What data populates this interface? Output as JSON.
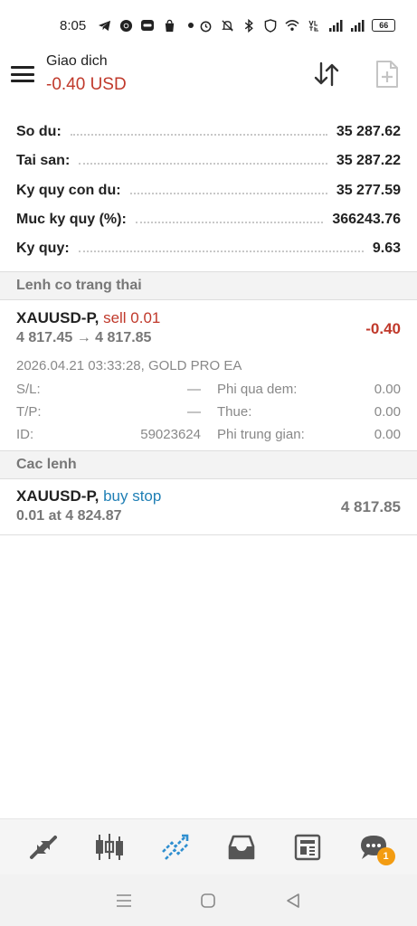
{
  "status_bar": {
    "time": "8:05",
    "battery": "66",
    "left_icons": [
      "telegram-icon",
      "chrome-icon",
      "zalo-icon",
      "shopee-icon",
      "dot-icon"
    ],
    "right_icons": [
      "alarm-icon",
      "mute-icon",
      "bluetooth-icon",
      "shield-icon",
      "wifi-icon",
      "volte-icon",
      "signal-icon",
      "signal-icon"
    ]
  },
  "header": {
    "title": "Giao dich",
    "profit": "-0.40 USD",
    "colors": {
      "loss": "#c0392b"
    }
  },
  "summary": [
    {
      "label": "So du:",
      "value": "35 287.62"
    },
    {
      "label": "Tai san:",
      "value": "35 287.22"
    },
    {
      "label": "Ky quy con du:",
      "value": "35 277.59"
    },
    {
      "label": "Muc ky quy (%):",
      "value": "366243.76"
    },
    {
      "label": "Ky quy:",
      "value": "9.63"
    }
  ],
  "sections": {
    "positions": "Lenh co trang thai",
    "orders": "Cac lenh"
  },
  "position": {
    "symbol": "XAUUSD-P,",
    "side": "sell 0.01",
    "prices": "4 817.45 → 4 817.85",
    "profit": "-0.40",
    "time_ea": "2026.04.21 03:33:28, GOLD PRO EA",
    "sl_label": "S/L:",
    "sl_value": "—",
    "tp_label": "T/P:",
    "tp_value": "—",
    "id_label": "ID:",
    "id_value": "59023624",
    "swap_label": "Phi qua dem:",
    "swap_value": "0.00",
    "tax_label": "Thue:",
    "tax_value": "0.00",
    "commission_label": "Phi trung gian:",
    "commission_value": "0.00"
  },
  "order": {
    "symbol": "XAUUSD-P,",
    "type": "buy stop",
    "volume_price": "0.01 at 4 824.87",
    "current_price": "4 817.85",
    "colors": {
      "buy": "#1f7fb5"
    }
  },
  "bottom_nav": {
    "items": [
      "quotes-icon",
      "chart-icon",
      "trade-icon",
      "history-icon",
      "news-icon",
      "chat-icon"
    ],
    "active": "trade-icon",
    "chat_badge": "1",
    "colors": {
      "active": "#2f8fd0",
      "inactive": "#555555",
      "badge": "#f39c12"
    }
  }
}
